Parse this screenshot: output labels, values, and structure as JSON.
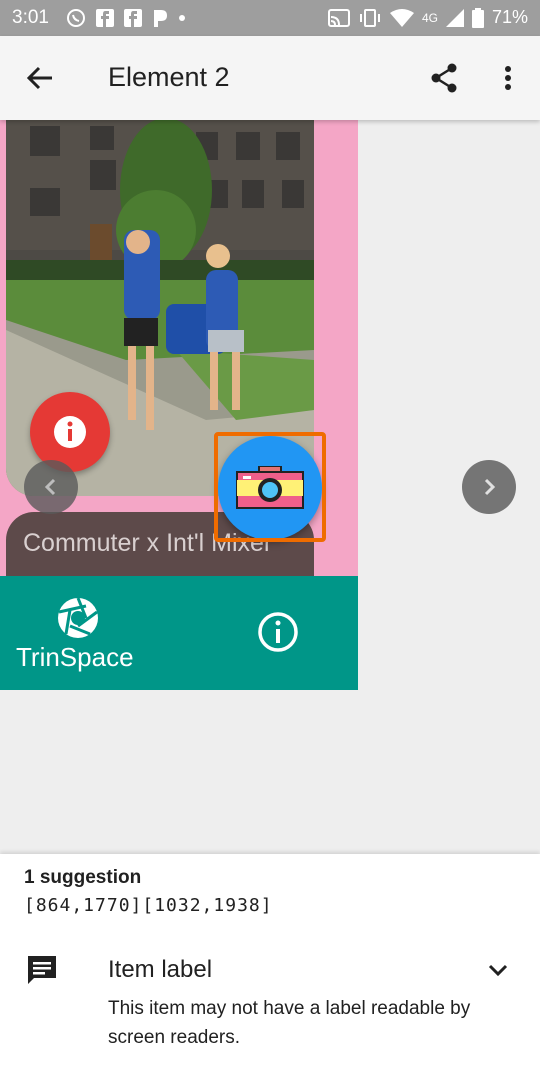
{
  "status_bar": {
    "time": "3:01",
    "network": "4G",
    "battery": "71%"
  },
  "app_bar": {
    "title": "Element 2"
  },
  "preview": {
    "event_title": "Commuter x Int'l Mixer",
    "brand": "TrinSpace"
  },
  "suggestions": {
    "count_label": "1 suggestion",
    "bounds": "[864,1770][1032,1938]",
    "items": [
      {
        "label": "Item label",
        "description": "This item may not have a label readable by screen readers."
      }
    ]
  },
  "colors": {
    "accent_teal": "#009688",
    "fab_blue": "#2196f3",
    "fab_red": "#e53935",
    "highlight": "#ef6c00",
    "preview_bg": "#f4a6c6"
  }
}
